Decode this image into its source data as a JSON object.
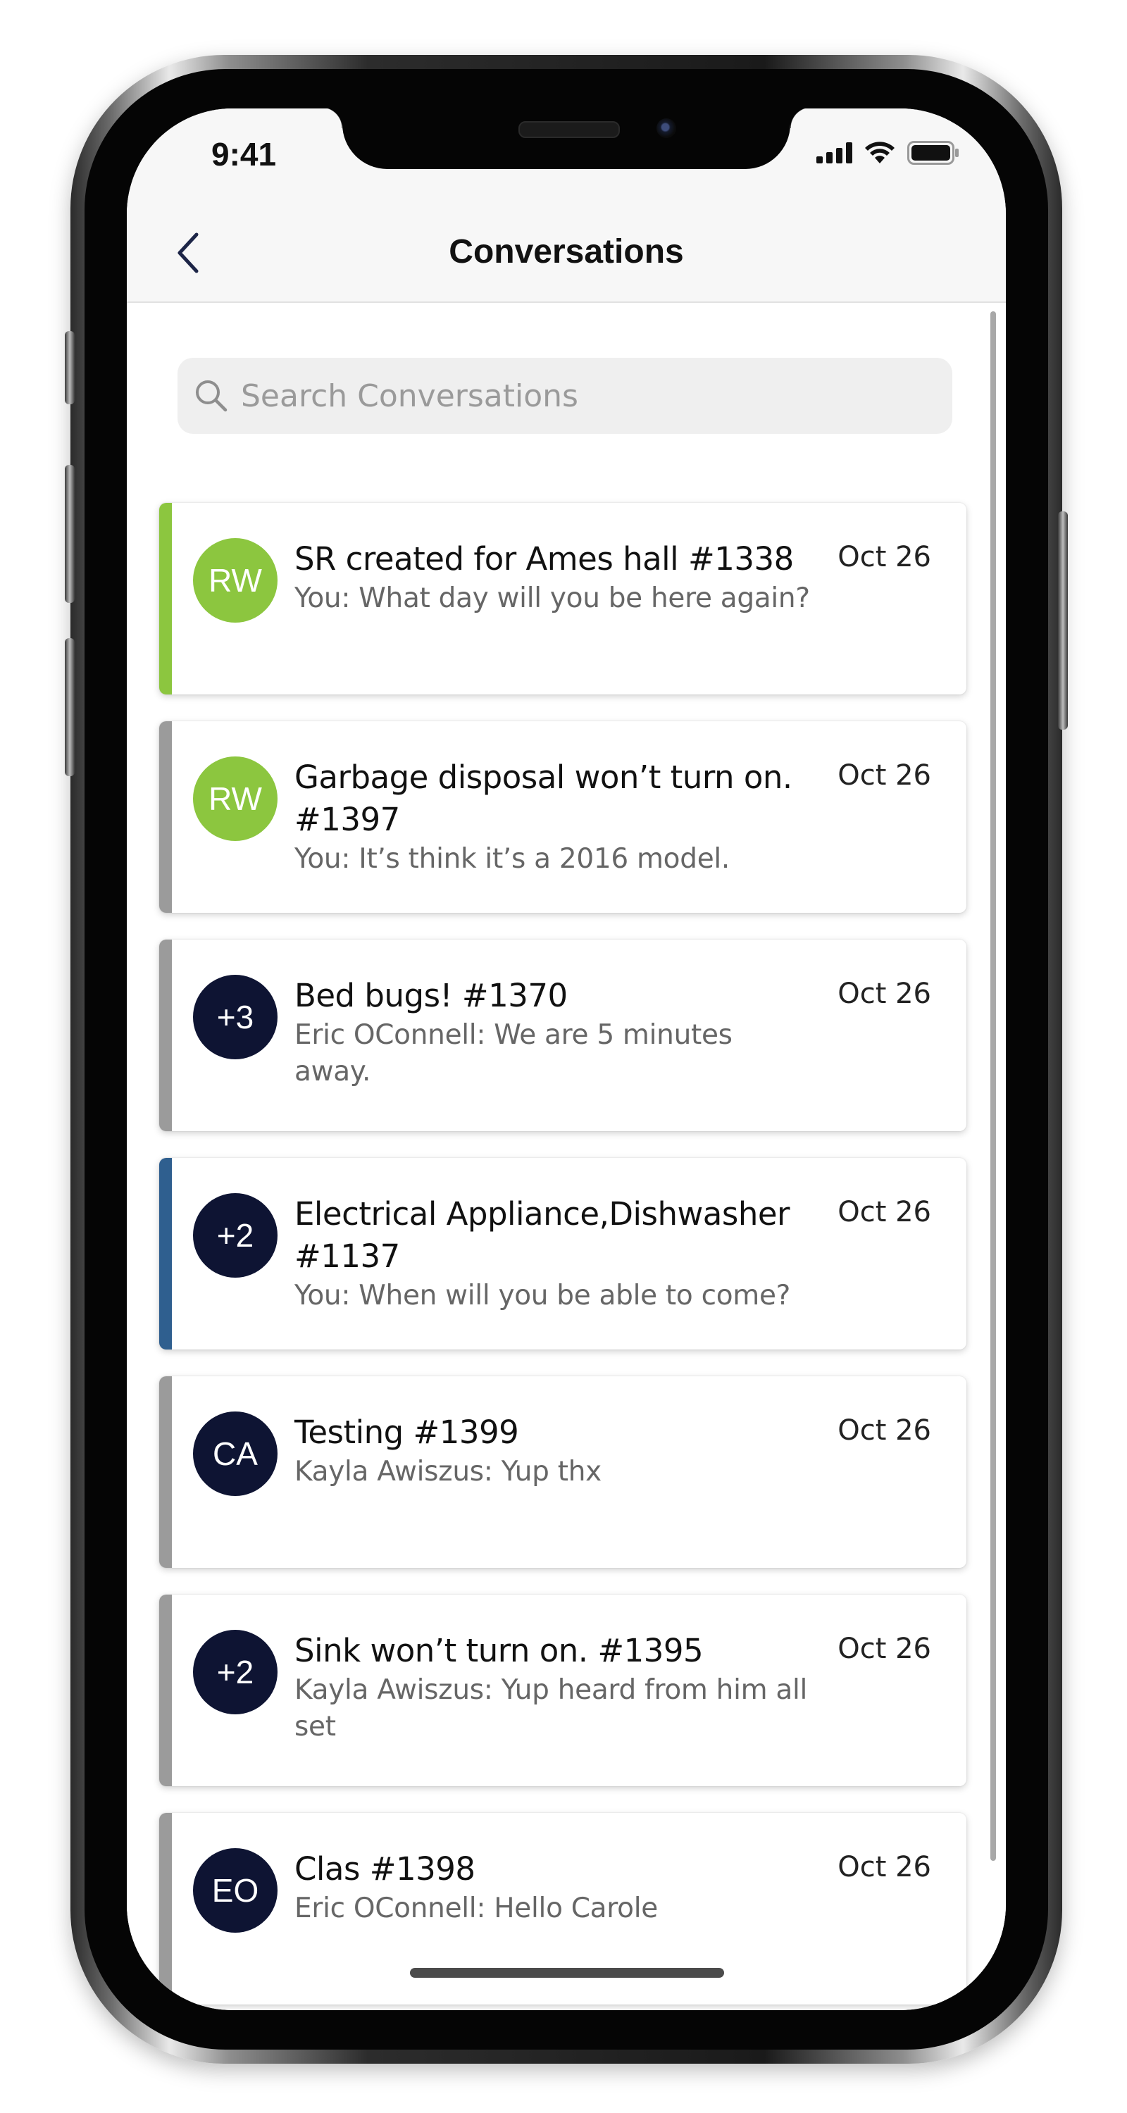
{
  "status_bar": {
    "time": "9:41",
    "icons": [
      "cellular-signal-icon",
      "wifi-icon",
      "battery-icon"
    ]
  },
  "header": {
    "title": "Conversations",
    "back_icon": "chevron-left-icon"
  },
  "search": {
    "placeholder": "Search Conversations",
    "value": "",
    "icon": "search-icon"
  },
  "colors": {
    "accent_green": "#8CC63F",
    "accent_gray": "#9B9B9B",
    "accent_blue": "#2F5F8F",
    "avatar_navy": "#0E1433",
    "avatar_green": "#8CC63F"
  },
  "conversations": [
    {
      "avatar": "RW",
      "avatar_color": "#8CC63F",
      "accent_color": "#8CC63F",
      "title": "SR created for Ames hall #1338",
      "preview": "You: What day will you be here again?",
      "date": "Oct 26"
    },
    {
      "avatar": "RW",
      "avatar_color": "#8CC63F",
      "accent_color": "#9B9B9B",
      "title": "Garbage disposal won’t turn on. #1397",
      "preview": "You: It’s think it’s a 2016 model.",
      "date": "Oct 26"
    },
    {
      "avatar": "+3",
      "avatar_color": "#0E1433",
      "accent_color": "#9B9B9B",
      "title": "Bed bugs! #1370",
      "preview": "Eric OConnell: We are 5 minutes away.",
      "date": "Oct 26"
    },
    {
      "avatar": "+2",
      "avatar_color": "#0E1433",
      "accent_color": "#2F5F8F",
      "title": "Electrical Appliance,Dishwasher #1137",
      "preview": "You: When will you be able to come?",
      "date": "Oct 26"
    },
    {
      "avatar": "CA",
      "avatar_color": "#0E1433",
      "accent_color": "#9B9B9B",
      "title": "Testing #1399",
      "preview": "Kayla Awiszus: Yup thx",
      "date": "Oct 26"
    },
    {
      "avatar": "+2",
      "avatar_color": "#0E1433",
      "accent_color": "#9B9B9B",
      "title": "Sink won’t turn on. #1395",
      "preview": "Kayla Awiszus: Yup heard from him all set",
      "date": "Oct 26"
    },
    {
      "avatar": "EO",
      "avatar_color": "#0E1433",
      "accent_color": "#9B9B9B",
      "title": "Clas #1398",
      "preview": "Eric OConnell: Hello Carole",
      "date": "Oct 26"
    }
  ]
}
